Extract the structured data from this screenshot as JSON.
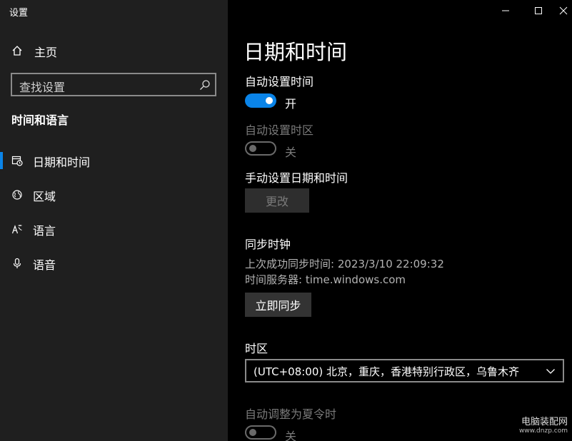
{
  "window": {
    "title": "设置",
    "controls": [
      "minimize",
      "maximize",
      "close"
    ]
  },
  "sidebar": {
    "home_label": "主页",
    "search_placeholder": "查找设置",
    "section_title": "时间和语言",
    "items": [
      {
        "label": "日期和时间",
        "icon": "calendar-clock-icon",
        "selected": true
      },
      {
        "label": "区域",
        "icon": "globe-icon",
        "selected": false
      },
      {
        "label": "语言",
        "icon": "language-icon",
        "selected": false
      },
      {
        "label": "语音",
        "icon": "microphone-icon",
        "selected": false
      }
    ]
  },
  "main": {
    "page_title": "日期和时间",
    "auto_time": {
      "label": "自动设置时间",
      "state_label": "开",
      "on": true
    },
    "auto_timezone": {
      "label": "自动设置时区",
      "state_label": "关",
      "on": false,
      "disabled": true
    },
    "manual_set": {
      "label": "手动设置日期和时间",
      "button": "更改"
    },
    "sync": {
      "title": "同步时钟",
      "last_sync": "上次成功同步时间: 2023/3/10 22:09:32",
      "server": "时间服务器: time.windows.com",
      "button": "立即同步"
    },
    "timezone": {
      "label": "时区",
      "value": "(UTC+08:00) 北京，重庆，香港特别行政区，乌鲁木齐"
    },
    "dst": {
      "label": "自动调整为夏令时",
      "state_label": "关",
      "on": false,
      "disabled": true
    }
  },
  "watermark": {
    "line1": "电脑装配网",
    "line2": "www.dnzp.com"
  },
  "colors": {
    "accent": "#0a84e8",
    "sidebar_bg": "#1f1f1f",
    "main_bg": "#000000",
    "disabled_text": "#7a7a7a"
  }
}
